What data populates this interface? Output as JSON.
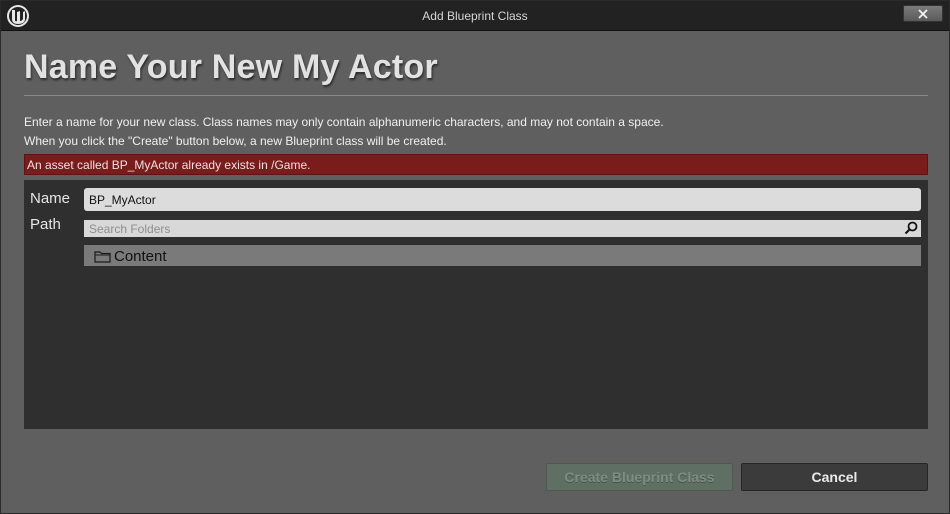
{
  "window": {
    "title": "Add Blueprint Class",
    "close_glyph": "✕"
  },
  "header": {
    "title": "Name Your New My Actor",
    "description_line1": "Enter a name for your new class. Class names may only contain alphanumeric characters, and may not contain a space.",
    "description_line2": "When you click the \"Create\" button below, a new Blueprint class will be created."
  },
  "error": {
    "message": "An asset called BP_MyActor already exists in /Game."
  },
  "form": {
    "name_label": "Name",
    "name_value": "BP_MyActor",
    "path_label": "Path",
    "search_placeholder": "Search Folders",
    "folders": [
      {
        "label": "Content",
        "icon": "folder-icon"
      }
    ]
  },
  "footer": {
    "create_label": "Create Blueprint Class",
    "cancel_label": "Cancel"
  },
  "colors": {
    "error_background": "#7a1c1c",
    "panel_background": "#2f2f2f",
    "create_button_disabled": "#5f6f63"
  }
}
